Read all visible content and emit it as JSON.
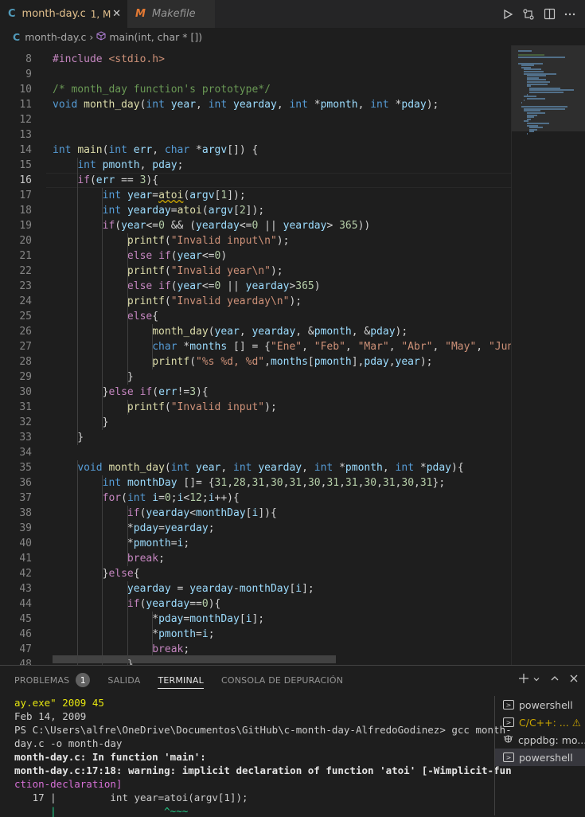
{
  "tabs": [
    {
      "icon": "C",
      "label": "month-day.c",
      "status": "1, M",
      "close": "✕"
    },
    {
      "icon": "M",
      "label": "Makefile"
    }
  ],
  "tab_actions": [
    "run-icon",
    "compare-icon",
    "split-editor-icon",
    "more-icon"
  ],
  "breadcrumb": {
    "file_icon": "C",
    "file": "month-day.c",
    "symbol": "main(int, char * [])"
  },
  "editor": {
    "current_line": 16,
    "lines": [
      {
        "n": 8,
        "code": "#include <stdio.h>"
      },
      {
        "n": 9,
        "code": ""
      },
      {
        "n": 10,
        "code": "/* month_day function's prototype*/"
      },
      {
        "n": 11,
        "code": "void month_day(int year, int yearday, int *pmonth, int *pday);"
      },
      {
        "n": 12,
        "code": ""
      },
      {
        "n": 13,
        "code": ""
      },
      {
        "n": 14,
        "code": "int main(int err, char *argv[]) {"
      },
      {
        "n": 15,
        "code": "    int pmonth, pday;"
      },
      {
        "n": 16,
        "code": "    if(err == 3){"
      },
      {
        "n": 17,
        "code": "        int year=atoi(argv[1]);"
      },
      {
        "n": 18,
        "code": "        int yearday=atoi(argv[2]);"
      },
      {
        "n": 19,
        "code": "        if(year<=0 && (yearday<=0 || yearday> 365))"
      },
      {
        "n": 20,
        "code": "            printf(\"Invalid input\\n\");"
      },
      {
        "n": 21,
        "code": "            else if(year<=0)"
      },
      {
        "n": 22,
        "code": "            printf(\"Invalid year\\n\");"
      },
      {
        "n": 23,
        "code": "            else if(year<=0 || yearday>365)"
      },
      {
        "n": 24,
        "code": "            printf(\"Invalid yearday\\n\");"
      },
      {
        "n": 25,
        "code": "            else{"
      },
      {
        "n": 26,
        "code": "                month_day(year, yearday, &pmonth, &pday);"
      },
      {
        "n": 27,
        "code": "                char *months [] = {\"Ene\", \"Feb\", \"Mar\", \"Abr\", \"May\", \"Jun\""
      },
      {
        "n": 28,
        "code": "                printf(\"%s %d, %d\",months[pmonth],pday,year);"
      },
      {
        "n": 29,
        "code": "            }"
      },
      {
        "n": 30,
        "code": "        }else if(err!=3){"
      },
      {
        "n": 31,
        "code": "            printf(\"Invalid input\");"
      },
      {
        "n": 32,
        "code": "        }"
      },
      {
        "n": 33,
        "code": "    }"
      },
      {
        "n": 34,
        "code": ""
      },
      {
        "n": 35,
        "code": "    void month_day(int year, int yearday, int *pmonth, int *pday){"
      },
      {
        "n": 36,
        "code": "        int monthDay []= {31,28,31,30,31,30,31,31,30,31,30,31};"
      },
      {
        "n": 37,
        "code": "        for(int i=0;i<12;i++){"
      },
      {
        "n": 38,
        "code": "            if(yearday<monthDay[i]){"
      },
      {
        "n": 39,
        "code": "            *pday=yearday;"
      },
      {
        "n": 40,
        "code": "            *pmonth=i;"
      },
      {
        "n": 41,
        "code": "            break;"
      },
      {
        "n": 42,
        "code": "        }else{"
      },
      {
        "n": 43,
        "code": "            yearday = yearday-monthDay[i];"
      },
      {
        "n": 44,
        "code": "            if(yearday==0){"
      },
      {
        "n": 45,
        "code": "                *pday=monthDay[i];"
      },
      {
        "n": 46,
        "code": "                *pmonth=i;"
      },
      {
        "n": 47,
        "code": "                break;"
      },
      {
        "n": 48,
        "code": "            }"
      }
    ]
  },
  "panel": {
    "tabs": [
      {
        "label": "PROBLEMAS",
        "badge": "1"
      },
      {
        "label": "SALIDA"
      },
      {
        "label": "TERMINAL",
        "active": true
      },
      {
        "label": "CONSOLA DE DEPURACIÓN"
      }
    ],
    "actions": [
      "add-terminal-icon",
      "chevron-down-icon",
      "maximize-icon",
      "close-icon"
    ],
    "terminal_lines": [
      "ay.exe\" 2009 45",
      "Feb 14, 2009",
      "PS C:\\Users\\alfre\\OneDrive\\Documentos\\GitHub\\c-month-day-AlfredoGodinez> gcc month-",
      "day.c -o month-day",
      "month-day.c: In function 'main':",
      "month-day.c:17:18: warning: implicit declaration of function 'atoi' [-Wimplicit-fun",
      "ction-declaration]",
      "   17 |         int year=atoi(argv[1]);",
      "      |                  ^~~~"
    ],
    "terminal_list": [
      {
        "label": "powershell"
      },
      {
        "label": "C/C++: ...",
        "warning": true
      },
      {
        "label": "cppdbg: mo..."
      },
      {
        "label": "powershell",
        "selected": true
      }
    ]
  }
}
